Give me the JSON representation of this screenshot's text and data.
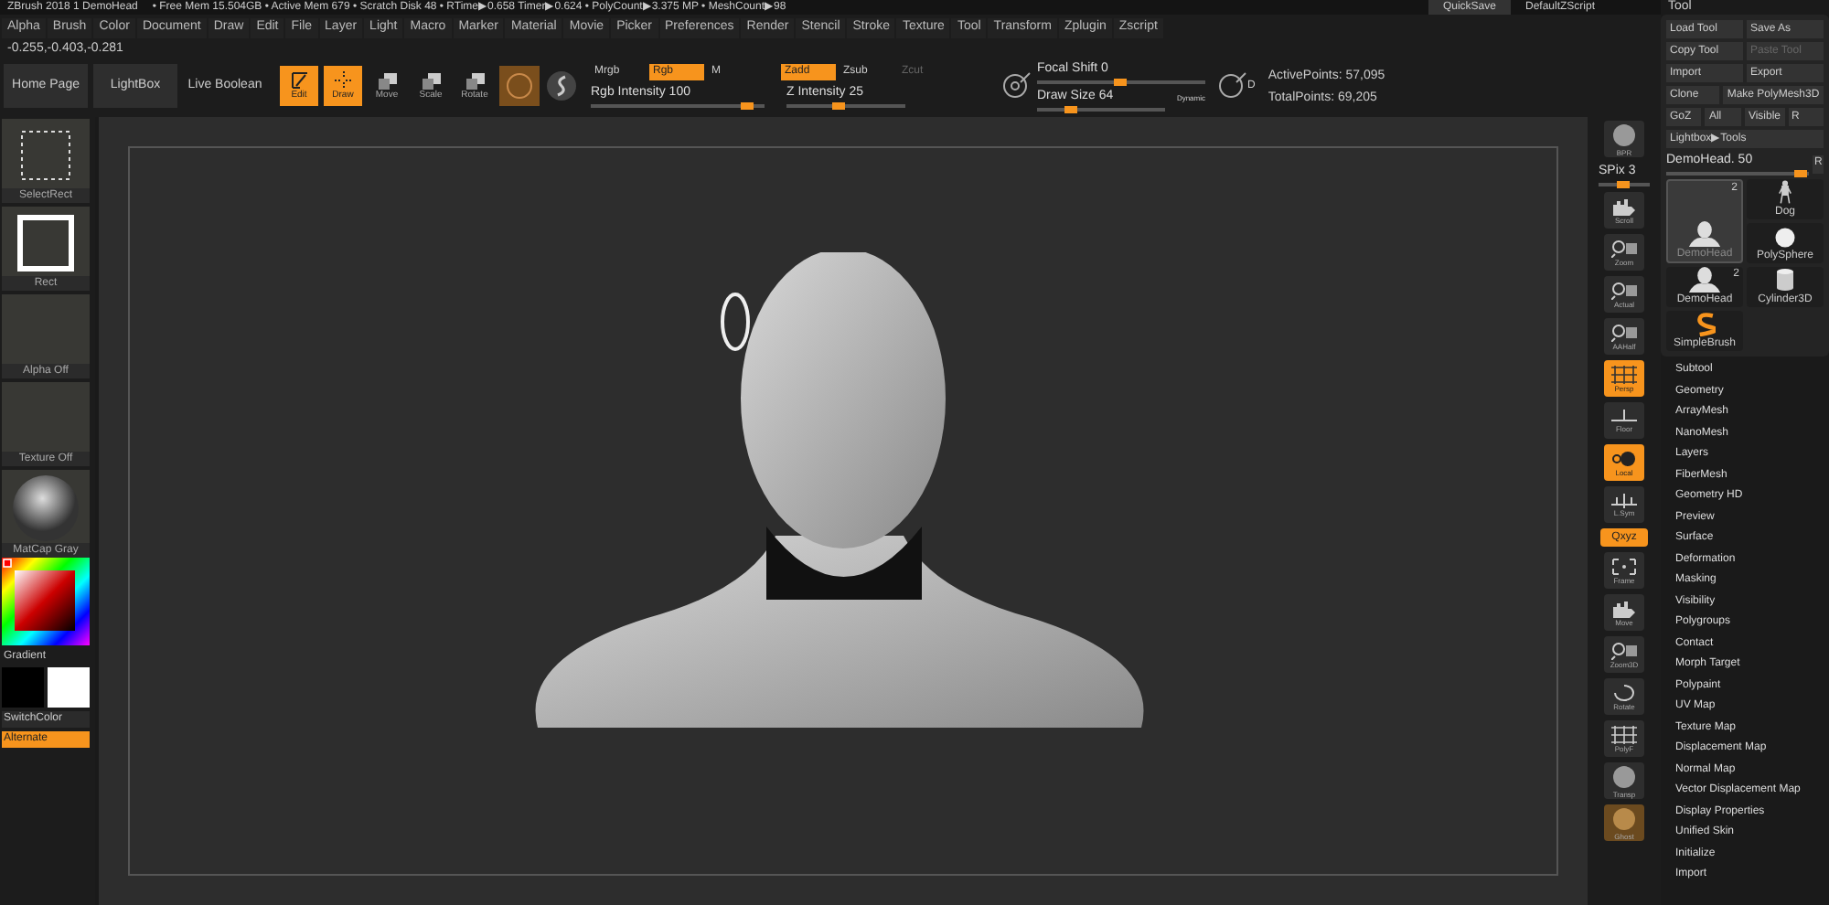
{
  "status_bar": {
    "title": "ZBrush 2018 1 DemoHead",
    "stats": "• Free Mem 15.504GB • Active Mem 679 • Scratch Disk 48 • RTime▶0.658 Timer▶0.624 • PolyCount▶3.375 MP • MeshCount▶98",
    "quicksave": "QuickSave",
    "script": "DefaultZScript"
  },
  "menu": [
    "Alpha",
    "Brush",
    "Color",
    "Document",
    "Draw",
    "Edit",
    "File",
    "Layer",
    "Light",
    "Macro",
    "Marker",
    "Material",
    "Movie",
    "Picker",
    "Preferences",
    "Render",
    "Stencil",
    "Stroke",
    "Texture",
    "Tool",
    "Transform",
    "Zplugin",
    "Zscript"
  ],
  "coordinates": "-0.255,-0.403,-0.281",
  "toolbar": {
    "buttons": [
      {
        "label": "Home Page"
      },
      {
        "label": "LightBox"
      },
      {
        "label": "Live Boolean"
      }
    ],
    "modes": [
      {
        "label": "Edit",
        "selected": true,
        "kind": "edit"
      },
      {
        "label": "Draw",
        "selected": true,
        "kind": "draw"
      },
      {
        "label": "Move",
        "selected": false,
        "kind": "move"
      },
      {
        "label": "Scale",
        "selected": false,
        "kind": "scale"
      },
      {
        "label": "Rotate",
        "selected": false,
        "kind": "rotate"
      }
    ],
    "color_modes": [
      {
        "label": "Mrgb",
        "on": false
      },
      {
        "label": "Rgb",
        "on": true
      },
      {
        "label": "M",
        "on": false
      }
    ],
    "z_modes": [
      {
        "label": "Zadd",
        "on": true,
        "disabled": false
      },
      {
        "label": "Zsub",
        "on": false,
        "disabled": false
      },
      {
        "label": "Zcut",
        "on": false,
        "disabled": true
      }
    ],
    "sliders_a": [
      {
        "label": "Rgb Intensity 100",
        "level": 0.9
      },
      {
        "label": "Z Intensity 25",
        "level": 0.45
      }
    ],
    "sliders_b": [
      {
        "label": "Focal Shift 0",
        "level": 0.5
      },
      {
        "label": "Draw Size 64",
        "level": 0.27
      }
    ],
    "dynamic": "Dynamic",
    "icon_b_label": "D",
    "points": [
      "ActivePoints: 57,095",
      "TotalPoints: 69,205"
    ]
  },
  "left_palette": [
    {
      "label": "SelectRect",
      "kind": "selectrect"
    },
    {
      "label": "Rect",
      "kind": "rect"
    },
    {
      "label": "Alpha Off",
      "kind": "blank"
    },
    {
      "label": "Texture Off",
      "kind": "blank"
    },
    {
      "label": "MatCap Gray",
      "kind": "sphere"
    }
  ],
  "color": {
    "gradient": "Gradient",
    "switch": "SwitchColor",
    "alternate": {
      "label": "Alternate",
      "on": true
    }
  },
  "shelf": [
    {
      "label": "BPR",
      "kind": "sphere",
      "on": false
    },
    {
      "label": "SPix 3",
      "kind": "slider",
      "level": 0.5
    },
    {
      "label": "Scroll",
      "kind": "hand",
      "on": false
    },
    {
      "label": "Zoom",
      "kind": "zoom",
      "on": false
    },
    {
      "label": "Actual",
      "kind": "zoom",
      "on": false
    },
    {
      "label": "AAHalf",
      "kind": "zoom",
      "on": false
    },
    {
      "label": "Persp",
      "kind": "grid",
      "on": true
    },
    {
      "label": "Floor",
      "kind": "floor",
      "on": false
    },
    {
      "label": "Local",
      "kind": "local",
      "on": true
    },
    {
      "label": "L.Sym",
      "kind": "sym",
      "on": false
    },
    {
      "label": "Qxyz",
      "kind": "pill",
      "on": true
    },
    {
      "label": "Frame",
      "kind": "frame",
      "on": false
    },
    {
      "label": "Move",
      "kind": "hand",
      "on": false
    },
    {
      "label": "Zoom3D",
      "kind": "zoom",
      "on": false
    },
    {
      "label": "Rotate",
      "kind": "rotate",
      "on": false
    },
    {
      "label": "PolyF",
      "kind": "grid",
      "on": false
    },
    {
      "label": "Transp",
      "kind": "sphere",
      "on": false
    },
    {
      "label": "Ghost",
      "kind": "ghost",
      "on": false
    }
  ],
  "tool_panel": {
    "title": "Tool",
    "button_rows": [
      [
        {
          "label": "Load Tool",
          "disabled": false
        },
        {
          "label": "Save As",
          "disabled": false
        }
      ],
      [
        {
          "label": "Copy Tool",
          "disabled": false
        },
        {
          "label": "Paste Tool",
          "disabled": true
        }
      ],
      [
        {
          "label": "Import",
          "disabled": false
        },
        {
          "label": "Export",
          "disabled": false
        }
      ],
      [
        {
          "label": "Clone",
          "disabled": false
        },
        {
          "label": "Make PolyMesh3D",
          "disabled": false
        }
      ],
      [
        {
          "label": "GoZ",
          "disabled": false
        },
        {
          "label": "All",
          "disabled": false
        },
        {
          "label": "Visible",
          "disabled": false
        },
        {
          "label": "R",
          "disabled": false
        }
      ]
    ],
    "lightbox": "Lightbox▶Tools",
    "slider": {
      "label": "DemoHead. 50",
      "level": 0.95
    },
    "slider_end": "R",
    "tools": [
      {
        "label": "DemoHead",
        "count": "2",
        "kind": "bust",
        "selected": true
      },
      {
        "label": "Dog",
        "kind": "figure",
        "selected": false
      },
      {
        "label": "PolySphere",
        "kind": "sphere",
        "selected": false
      },
      {
        "label": "DemoHead",
        "count": "2",
        "kind": "bust",
        "selected": false
      },
      {
        "label": "Cylinder3D",
        "kind": "cylinder",
        "selected": false
      },
      {
        "label": "SimpleBrush",
        "kind": "brush",
        "selected": false
      }
    ],
    "sections": [
      "Subtool",
      "Geometry",
      "ArrayMesh",
      "NanoMesh",
      "Layers",
      "FiberMesh",
      "Geometry HD",
      "Preview",
      "Surface",
      "Deformation",
      "Masking",
      "Visibility",
      "Polygroups",
      "Contact",
      "Morph Target",
      "Polypaint",
      "UV Map",
      "Texture Map",
      "Displacement Map",
      "Normal Map",
      "Vector Displacement Map",
      "Display Properties",
      "Unified Skin",
      "Initialize",
      "Import"
    ]
  }
}
